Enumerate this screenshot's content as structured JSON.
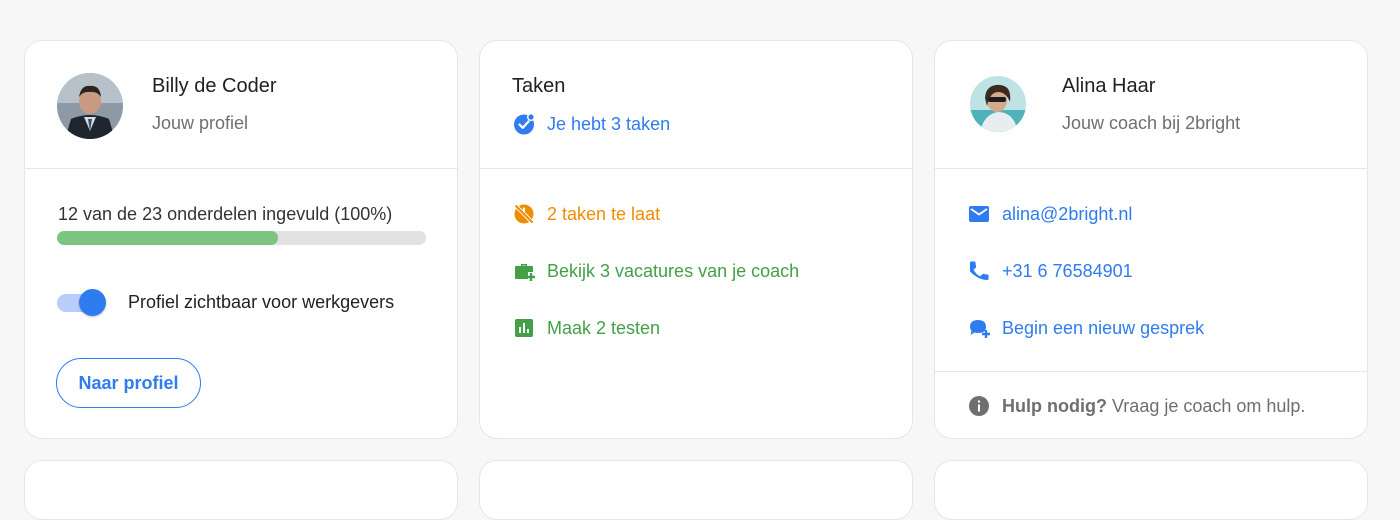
{
  "profile_card": {
    "name": "Billy de Coder",
    "subtitle": "Jouw profiel",
    "progress_text": "12 van de 23 onderdelen ingevuld (100%)",
    "progress_fraction": 0.6,
    "toggle_on": true,
    "toggle_label": "Profiel zichtbaar voor werkgevers",
    "button_label": "Naar profiel"
  },
  "tasks_card": {
    "title": "Taken",
    "summary": "Je hebt 3 taken",
    "items": [
      {
        "label": "2 taken te laat",
        "icon": "clock-off-icon",
        "color": "#f08c00"
      },
      {
        "label": "Bekijk 3 vacatures van je coach",
        "icon": "briefcase-add-icon",
        "color": "#43a047"
      },
      {
        "label": "Maak 2 testen",
        "icon": "bar-chart-icon",
        "color": "#43a047"
      }
    ]
  },
  "coach_card": {
    "name": "Alina Haar",
    "subtitle": "Jouw coach bij 2bright",
    "email": "alina@2bright.nl",
    "phone": "+31 6 76584901",
    "chat": "Begin een nieuw gesprek",
    "help_bold": "Hulp nodig?",
    "help_text": " Vraag je coach om hulp."
  },
  "colors": {
    "accent": "#2f7bf0",
    "success": "#43a047",
    "warning": "#f08c00",
    "progress": "#7cc47f"
  }
}
